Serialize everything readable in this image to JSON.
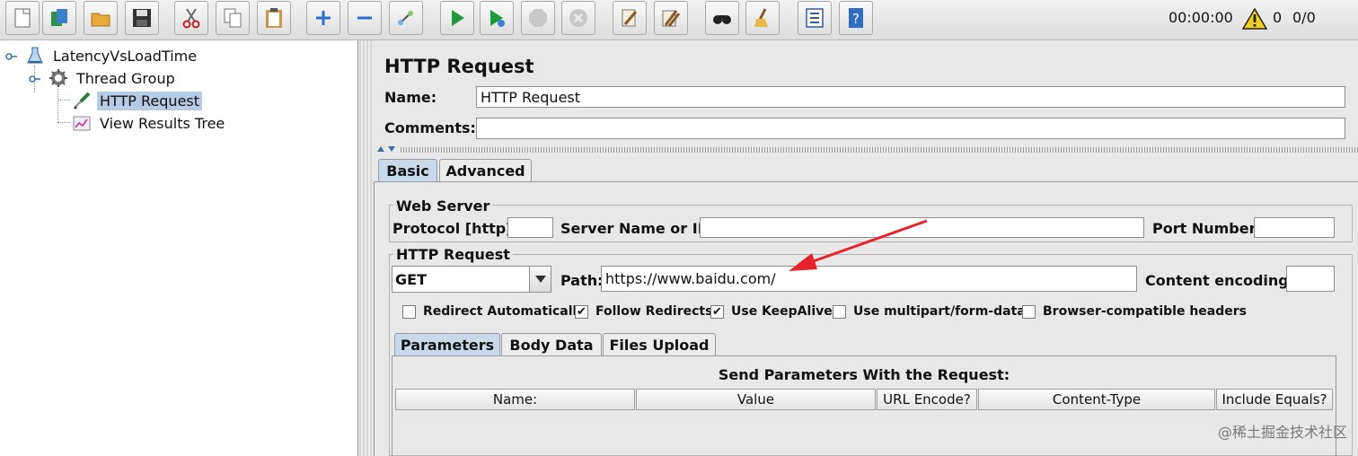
{
  "status": {
    "timer": "00:00:00",
    "warnings": "0",
    "threads": "0/0"
  },
  "tree": {
    "items": [
      {
        "label": "LatencyVsLoadTime"
      },
      {
        "label": "Thread Group"
      },
      {
        "label": "HTTP Request"
      },
      {
        "label": "View Results Tree"
      }
    ]
  },
  "main": {
    "title": "HTTP Request",
    "name_label": "Name:",
    "name_value": "HTTP Request",
    "comments_label": "Comments:",
    "comments_value": "",
    "tabs": [
      {
        "label": "Basic"
      },
      {
        "label": "Advanced"
      }
    ],
    "web_server": {
      "legend": "Web Server",
      "protocol_label": "Protocol [http]:",
      "protocol_value": "",
      "server_label": "Server Name or IP:",
      "server_value": "",
      "port_label": "Port Number:",
      "port_value": ""
    },
    "http_request": {
      "legend": "HTTP Request",
      "method": "GET",
      "path_label": "Path:",
      "path_value": "https://www.baidu.com/",
      "encoding_label": "Content encoding:",
      "encoding_value": ""
    },
    "checkboxes": [
      {
        "label": "Redirect Automatically",
        "checked": false,
        "mark": ""
      },
      {
        "label": "Follow Redirects",
        "checked": true,
        "mark": "✔"
      },
      {
        "label": "Use KeepAlive",
        "checked": true,
        "mark": "✔"
      },
      {
        "label": "Use multipart/form-data",
        "checked": false,
        "mark": ""
      },
      {
        "label": "Browser-compatible headers",
        "checked": false,
        "mark": ""
      }
    ],
    "param_tabs": [
      {
        "label": "Parameters"
      },
      {
        "label": "Body Data"
      },
      {
        "label": "Files Upload"
      }
    ],
    "params_title": "Send Parameters With the Request:",
    "columns": [
      "Name:",
      "Value",
      "URL Encode?",
      "Content-Type",
      "Include Equals?"
    ]
  },
  "watermark": "@稀土掘金技术社区",
  "colors": {
    "selection": "#b6cbe6",
    "active_tab": "#c9d9ec",
    "annotation_arrow": "#e8222a"
  },
  "icons": [
    "new-icon",
    "templates-icon",
    "open-icon",
    "save-icon",
    "cut-icon",
    "copy-icon",
    "paste-icon",
    "expand-icon",
    "collapse-icon",
    "toggle-icon",
    "start-icon",
    "start-no-pause-icon",
    "stop-icon",
    "shutdown-icon",
    "clear-icon",
    "clear-all-icon",
    "search-icon",
    "reset-search-icon",
    "function-helper-icon",
    "help-icon",
    "warning-icon"
  ]
}
